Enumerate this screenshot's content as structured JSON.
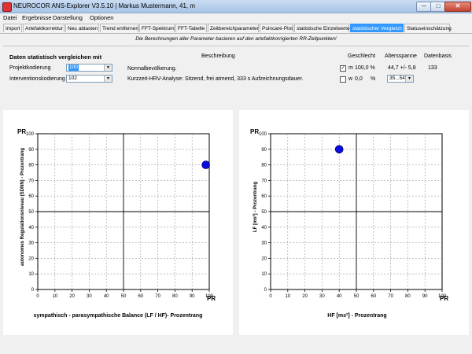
{
  "window": {
    "title": "NEUROCOR ANS-Explorer V3.5.10  |  Markus Mustermann, 41, m",
    "min": "─",
    "max": "□",
    "close": "✕"
  },
  "menu": [
    "Datei",
    "Ergebnisse",
    "Darstellung",
    "Optionen"
  ],
  "tabs": [
    "Import",
    "Artefaktkorrektur",
    "Neu ablasten",
    "Trend entfernen",
    "FFT-Spektrum",
    "FFT-Tabelle",
    "Zeitbereichparameter",
    "Poincaré-Plot",
    "statistische Einzelwerte",
    "statistischer Vergleich",
    "Statuseinschätzung"
  ],
  "active_tab": "statistischer Vergleich",
  "note": "Die Berechnungen aller Parameter basieren auf den artefaktkorrigierten RR-Zeitpunkten!",
  "params": {
    "heading": "Daten statistisch vergleichen mit",
    "col_desc": "Beschreibung",
    "col_gender": "Geschlecht",
    "col_age": "Altersspanne",
    "col_base": "Datenbasis",
    "row1_label": "Projektkodierung",
    "row1_value": "100",
    "row1_desc": "Normalbevölkerung.",
    "row2_label": "Interventionskodierung",
    "row2_value": "102",
    "row2_desc": "Kurzzeit-HRV-Analyse: Sitzend, frei atmend, 333 s Aufzeichnungsdauer.",
    "m_label": "m",
    "m_value": "100,0 %",
    "w_label": "w",
    "w_value": "0,0",
    "w_unit": "%",
    "age_value": "44,7 +/- 5,8",
    "age_range": "35...54",
    "base_value": "133"
  },
  "chart_data": [
    {
      "type": "scatter",
      "ylabel_top": "PR",
      "xlabel_right": "PR",
      "ylabel": "autonomes Regulationsniveau (SDNN) - Prozentrang",
      "xlabel": "sympathisch - parasympathische Balance (LF / HF)- Prozentrang",
      "xlim": [
        0,
        100
      ],
      "ylim": [
        0,
        100
      ],
      "xticks": [
        "0",
        "10",
        "20",
        "30",
        "40",
        "50",
        "60",
        "70",
        "80",
        "90",
        "100"
      ],
      "yticks": [
        "0",
        "10",
        "20",
        "30",
        "40",
        "50",
        "60",
        "70",
        "80",
        "90",
        "100"
      ],
      "grid": true,
      "reference_lines": {
        "x": 50,
        "y": 50
      },
      "points": [
        {
          "x": 98,
          "y": 80
        }
      ],
      "point_color": "#0a0adc"
    },
    {
      "type": "scatter",
      "ylabel_top": "PR",
      "xlabel_right": "PR",
      "ylabel": "LF [ms²] - Prozentrang",
      "xlabel": "HF [ms²] - Prozentrang",
      "xlim": [
        0,
        100
      ],
      "ylim": [
        0,
        100
      ],
      "xticks": [
        "0",
        "10",
        "20",
        "30",
        "40",
        "50",
        "60",
        "70",
        "80",
        "90",
        "100"
      ],
      "yticks": [
        "0",
        "10",
        "20",
        "30",
        "40",
        "50",
        "60",
        "70",
        "80",
        "90",
        "100"
      ],
      "grid": true,
      "reference_lines": {
        "x": 50,
        "y": 50
      },
      "points": [
        {
          "x": 40,
          "y": 90
        }
      ],
      "point_color": "#0a0adc"
    }
  ]
}
